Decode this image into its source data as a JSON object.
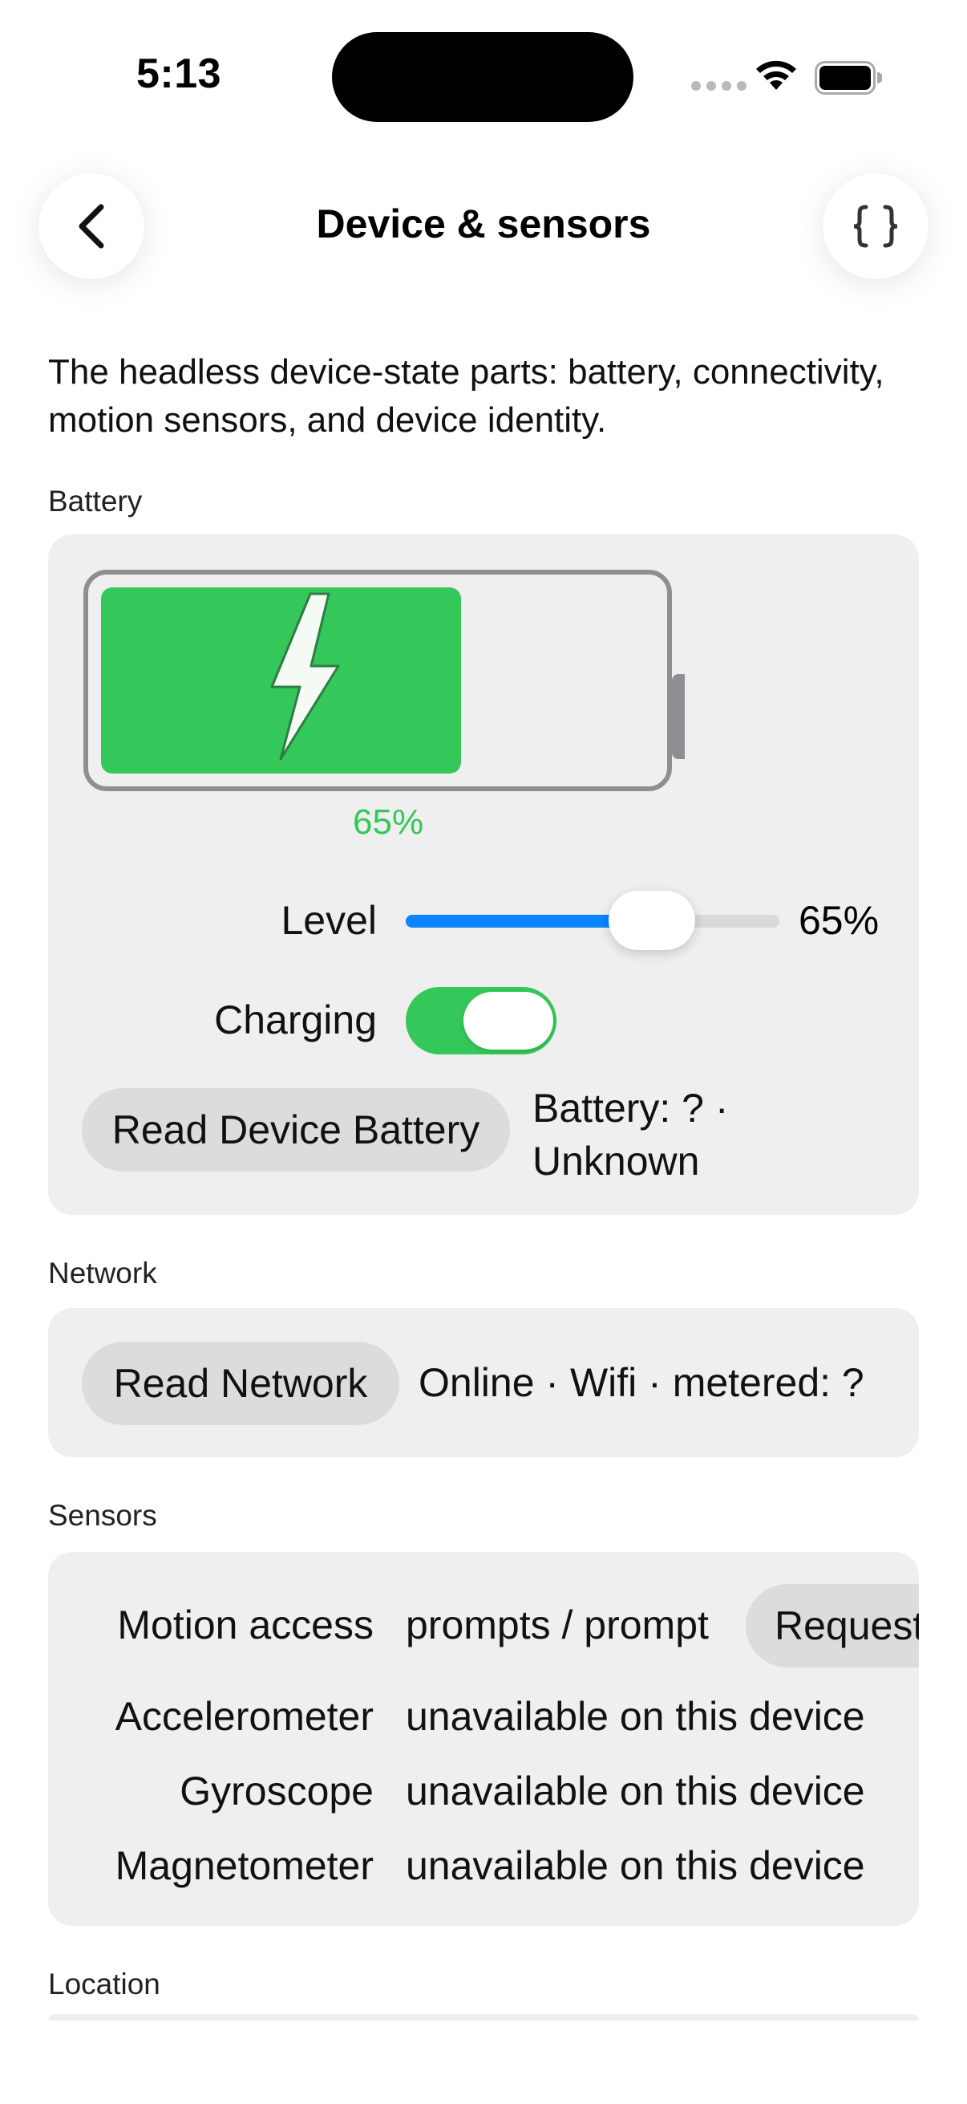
{
  "status_bar": {
    "time": "5:13"
  },
  "nav": {
    "title": "Device & sensors",
    "back_icon": "chevron-left-icon",
    "code_icon": "curly-braces-icon"
  },
  "intro": "The headless device-state parts: battery, connectivity, motion sensors, and device identity.",
  "battery": {
    "section_label": "Battery",
    "level": 0.65,
    "percent_label": "65%",
    "level_label": "Level",
    "level_value": "65%",
    "charging_label": "Charging",
    "charging": true,
    "read_button": "Read Device Battery",
    "status_line1": "Battery: ? ·",
    "status_line2": "Unknown",
    "fill_color": "#34c759",
    "accent_color": "#0a84ff"
  },
  "network": {
    "section_label": "Network",
    "read_button": "Read Network",
    "status": "Online · Wifi · metered: ?"
  },
  "sensors": {
    "section_label": "Sensors",
    "motion_access_label": "Motion access",
    "motion_access_value": "prompts / prompt",
    "request_button": "Request",
    "rows": [
      {
        "label": "Accelerometer",
        "value": "unavailable on this device"
      },
      {
        "label": "Gyroscope",
        "value": "unavailable on this device"
      },
      {
        "label": "Magnetometer",
        "value": "unavailable on this device"
      }
    ]
  },
  "location": {
    "section_label": "Location"
  }
}
